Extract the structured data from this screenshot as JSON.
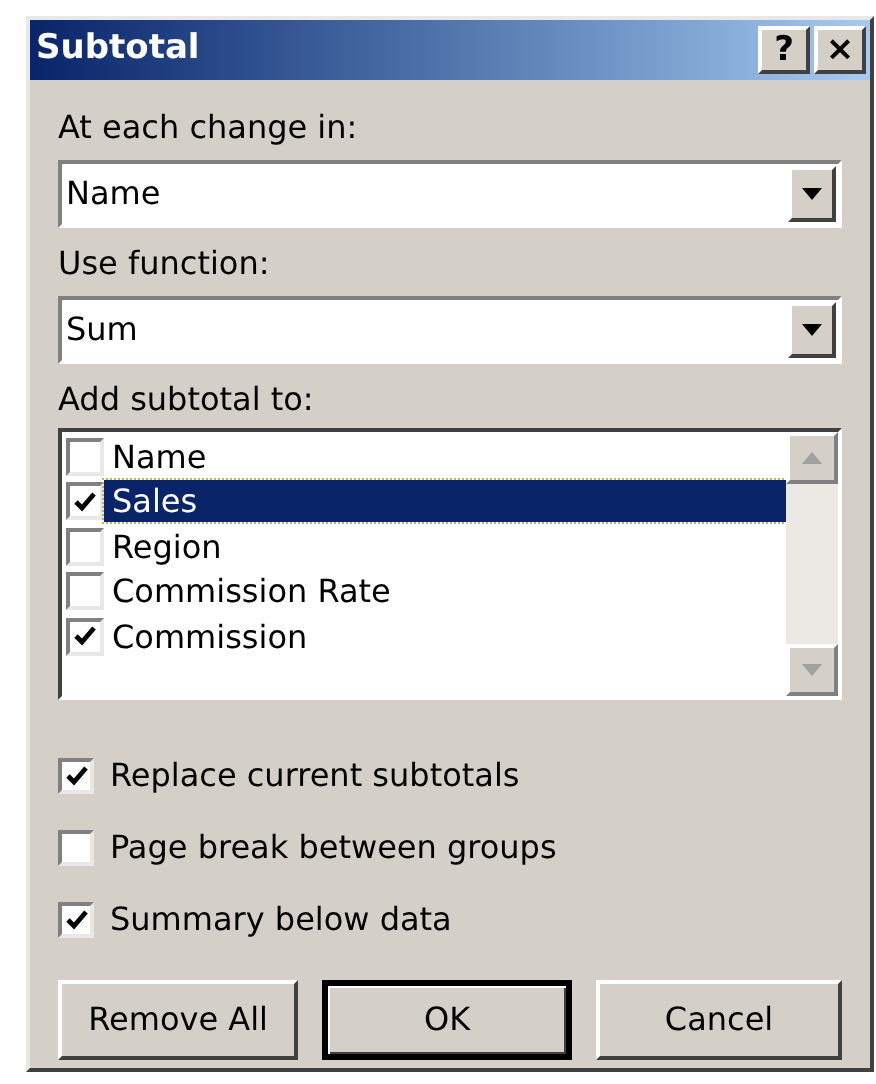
{
  "window": {
    "title": "Subtotal",
    "title_buttons": [
      "?",
      "×"
    ]
  },
  "change_field": {
    "label": "At each change in:",
    "value": "Name"
  },
  "function_field": {
    "label": "Use function:",
    "value": "Sum"
  },
  "subtotal_list": {
    "label": "Add subtotal to:",
    "items": [
      {
        "label": "Name",
        "checked": false,
        "selected": false
      },
      {
        "label": "Sales",
        "checked": true,
        "selected": true
      },
      {
        "label": "Region",
        "checked": false,
        "selected": false
      },
      {
        "label": "Commission Rate",
        "checked": false,
        "selected": false
      },
      {
        "label": "Commission",
        "checked": true,
        "selected": false
      }
    ]
  },
  "options": [
    {
      "label": "Replace current subtotals",
      "checked": true
    },
    {
      "label": "Page break between groups",
      "checked": false
    },
    {
      "label": "Summary below data",
      "checked": true
    }
  ],
  "buttons": [
    {
      "label": "Remove All",
      "default": false
    },
    {
      "label": "OK",
      "default": true
    },
    {
      "label": "Cancel",
      "default": false
    }
  ]
}
